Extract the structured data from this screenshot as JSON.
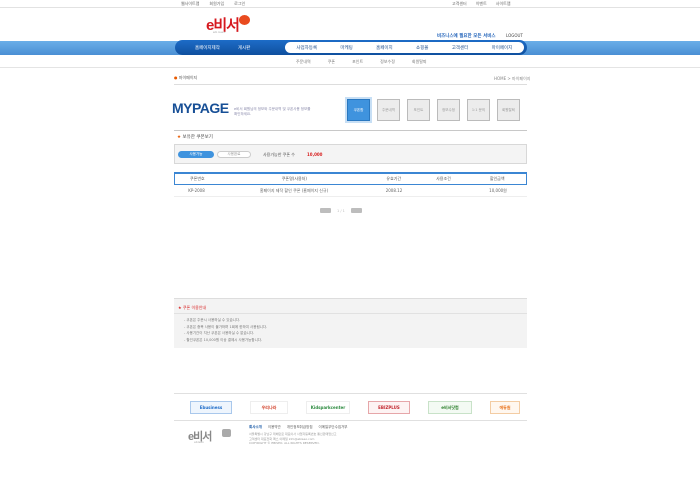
{
  "topbar": {
    "left_links": [
      "웹사이트맵",
      "회원가입",
      "로그인"
    ],
    "right_links": [
      "고객센터",
      "이벤트",
      "사이트맵"
    ]
  },
  "header": {
    "logo_text": "e비서",
    "logo_sub": "ebiseo",
    "slogan": "비즈니스에 필요한 모든 서비스",
    "logout_label": "LOGOUT"
  },
  "nav": {
    "left": [
      "홈페이지제작",
      "게시판"
    ],
    "right": [
      "사업자등록",
      "마케팅",
      "홈페이지",
      "쇼핑몰",
      "고객센터",
      "마이페이지"
    ]
  },
  "subnav": [
    "주문내역",
    "쿠폰",
    "포인트",
    "정보수정",
    "회원탈퇴"
  ],
  "breadcrumb": {
    "left": "마이페이지",
    "right": "HOME > 마이페이지"
  },
  "mypage": {
    "title": "MYPAGE",
    "desc": "e비서 회원님의 정보와 주문내역 및 쿠폰사용 정보를 확인하세요.",
    "icons": [
      {
        "label": "쿠폰함",
        "active": true
      },
      {
        "label": "주문내역",
        "active": false
      },
      {
        "label": "포인트",
        "active": false
      },
      {
        "label": "정보수정",
        "active": false
      },
      {
        "label": "1:1 문의",
        "active": false
      },
      {
        "label": "회원탈퇴",
        "active": false
      }
    ]
  },
  "section": {
    "title": "보유한 쿠폰보기",
    "tabs": [
      "사용가능",
      "사용완료"
    ],
    "coupon_label": "사용가능한 쿠폰 수",
    "coupon_count": "10,000"
  },
  "table": {
    "headers": [
      "쿠폰번호",
      "쿠폰명(사용처)",
      "유효기간",
      "사용조건",
      "할인금액"
    ],
    "rows": [
      [
        "KP-2008",
        "홈페이지 제작 할인 쿠폰 (홈페이지 신규)",
        "2008.12",
        "",
        "10,000원"
      ]
    ]
  },
  "pager": {
    "text": "1 / 1"
  },
  "notice": {
    "title": "쿠폰 이용안내",
    "items": [
      "- 쿠폰은 주문시 사용하실 수 있습니다.",
      "- 쿠폰은 중복 사용이 불가하며 1회에 한하여 사용됩니다.",
      "- 사용기간이 지난 쿠폰은 사용하실 수 없습니다.",
      "- 할인쿠폰은 10,000원 이상 결제시 사용가능합니다."
    ]
  },
  "partners": [
    "Ebusiness",
    "우리나라",
    "Kidsparkcenter",
    "EBIZPLUS",
    "e비서닷컴",
    "에듀원"
  ],
  "footer": {
    "links": [
      "회사소개",
      "이용약관",
      "개인정보취급방침",
      "이메일무단수집거부"
    ],
    "info": [
      "서울특별시 강남구 테헤란로 대표이사 사업자등록번호 통신판매업신고",
      "고객센터 대표전화 팩스 이메일 info@ebiseo.com",
      "COPYRIGHT © EBISEO. ALL RIGHTS RESERVED."
    ]
  }
}
